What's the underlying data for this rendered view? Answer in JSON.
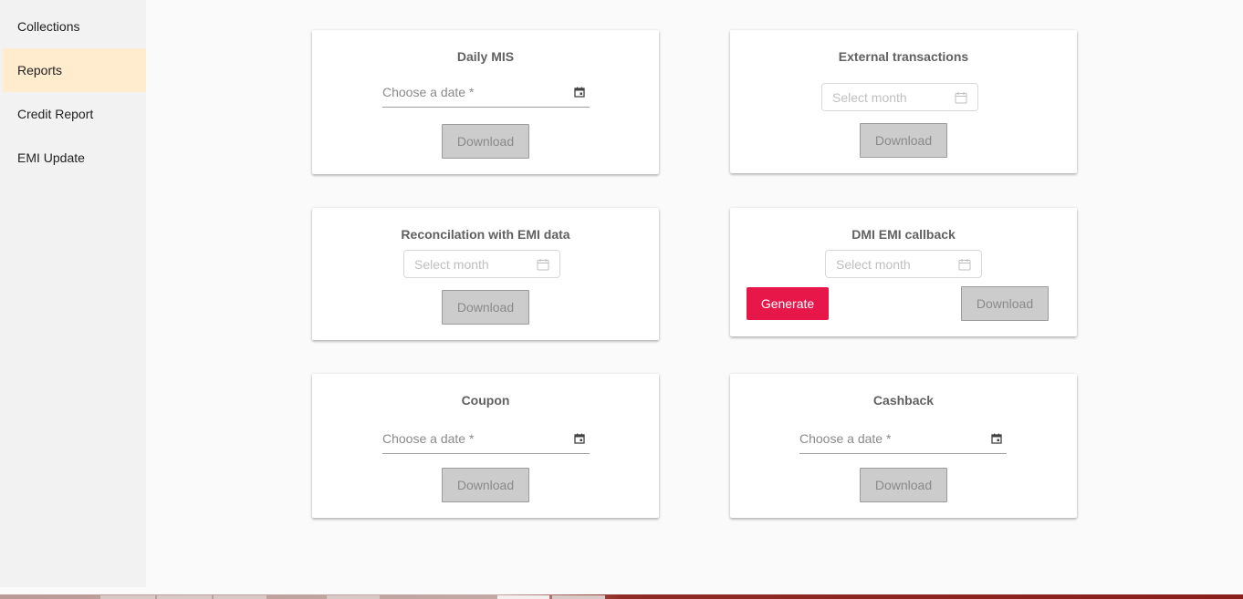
{
  "sidebar": {
    "items": [
      {
        "label": "Collections"
      },
      {
        "label": "Reports"
      },
      {
        "label": "Credit Report"
      },
      {
        "label": "EMI Update"
      }
    ]
  },
  "cards": {
    "daily_mis": {
      "title": "Daily MIS",
      "placeholder": "Choose a date *",
      "download": "Download"
    },
    "external_transactions": {
      "title": "External transactions",
      "placeholder": "Select month",
      "download": "Download"
    },
    "reconciliation": {
      "title": "Reconcilation with EMI data",
      "placeholder": "Select month",
      "download": "Download"
    },
    "dmi_emi_callback": {
      "title": "DMI EMI callback",
      "placeholder": "Select month",
      "generate": "Generate",
      "download": "Download"
    },
    "coupon": {
      "title": "Coupon",
      "placeholder": "Choose a date *",
      "download": "Download"
    },
    "cashback": {
      "title": "Cashback",
      "placeholder": "Choose a date *",
      "download": "Download"
    }
  },
  "colors": {
    "active_sidebar": "#ffecce",
    "generate_button": "#e8174a",
    "disabled_button": "#cccccc"
  },
  "icons": {
    "date_picker": "calendar-event-icon",
    "month_picker": "calendar-outline-icon"
  }
}
